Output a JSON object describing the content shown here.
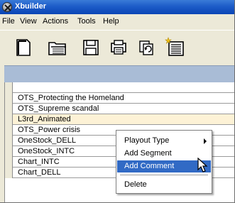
{
  "window": {
    "title": "Xbuilder"
  },
  "menubar": {
    "items": [
      "File",
      "View",
      "Actions",
      "Tools",
      "Help"
    ]
  },
  "toolbar": {
    "buttons": [
      {
        "icon": "new-document-icon"
      },
      {
        "icon": "open-folder-icon"
      },
      {
        "icon": "save-disk-icon"
      },
      {
        "icon": "print-icon"
      },
      {
        "icon": "refresh-icon"
      },
      {
        "icon": "new-playlist-icon"
      }
    ]
  },
  "list": {
    "rows": [
      {
        "label": ""
      },
      {
        "label": "OTS_Protecting the Homeland"
      },
      {
        "label": "OTS_Supreme scandal"
      },
      {
        "label": "L3rd_Animated",
        "highlighted": true
      },
      {
        "label": "OTS_Power crisis"
      },
      {
        "label": "OneStock_DELL"
      },
      {
        "label": "OneStock_INTC"
      },
      {
        "label": "Chart_INTC"
      },
      {
        "label": "Chart_DELL"
      }
    ]
  },
  "context_menu": {
    "items": [
      {
        "label": "Playout Type",
        "submenu": true
      },
      {
        "label": "Add Segment"
      },
      {
        "label": "Add Comment",
        "active": true
      },
      {
        "label": "Delete"
      }
    ]
  },
  "colors": {
    "title_bar": "#0a45b5",
    "highlight_row": "#fdf2d6",
    "menu_active": "#316ac5",
    "panel_header": "#a9bcd6"
  }
}
